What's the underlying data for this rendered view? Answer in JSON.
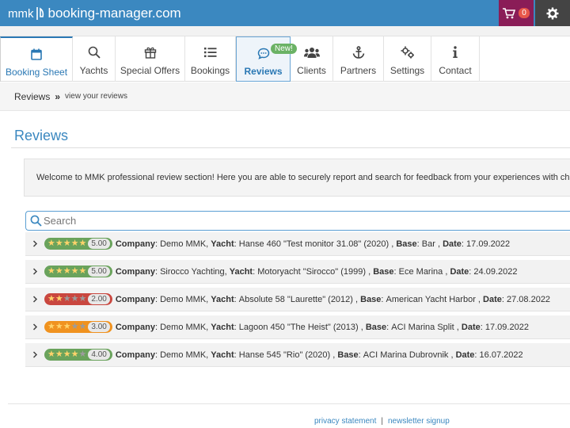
{
  "header": {
    "logo_prefix": "mmk",
    "logo_text": "booking-manager.com",
    "cart_count": "0"
  },
  "tabs": [
    {
      "label": "Booking Sheet",
      "icon": "calendar-icon"
    },
    {
      "label": "Yachts",
      "icon": "search-icon"
    },
    {
      "label": "Special Offers",
      "icon": "gift-icon"
    },
    {
      "label": "Bookings",
      "icon": "list-icon"
    },
    {
      "label": "Reviews",
      "icon": "comment-icon",
      "badge": "New!"
    },
    {
      "label": "Clients",
      "icon": "users-icon"
    },
    {
      "label": "Partners",
      "icon": "anchor-icon"
    },
    {
      "label": "Settings",
      "icon": "gears-icon"
    },
    {
      "label": "Contact",
      "icon": "info-icon"
    }
  ],
  "breadcrumb": {
    "main": "Reviews",
    "separator": "»",
    "sub": "view your reviews"
  },
  "page": {
    "title": "Reviews",
    "welcome": "Welcome to MMK professional review section! Here you are able to securely report and search for feedback from your experiences with charter operators."
  },
  "search": {
    "placeholder": "Search"
  },
  "labels": {
    "company": "Company",
    "yacht": "Yacht",
    "base": "Base",
    "date": "Date"
  },
  "reviews": [
    {
      "rating": 5,
      "rating_label": "5.00",
      "color": "#6aa35c",
      "company": "Demo MMK",
      "yacht": "Hanse 460 \"Test monitor 31.08\" (2020)",
      "base": "Bar",
      "date": "17.09.2022"
    },
    {
      "rating": 5,
      "rating_label": "5.00",
      "color": "#6aa35c",
      "company": "Sirocco Yachting",
      "yacht": "Motoryacht \"Sirocco\" (1999)",
      "base": "Ece Marina",
      "date": "24.09.2022"
    },
    {
      "rating": 2,
      "rating_label": "2.00",
      "color": "#c9473f",
      "company": "Demo MMK",
      "yacht": "Absolute 58 \"Laurette\" (2012)",
      "base": "American Yacht Harbor",
      "date": "27.08.2022"
    },
    {
      "rating": 3,
      "rating_label": "3.00",
      "color": "#f0921f",
      "company": "Demo MMK",
      "yacht": "Lagoon 450 \"The Heist\" (2013)",
      "base": "ACI Marina Split",
      "date": "17.09.2022"
    },
    {
      "rating": 4,
      "rating_label": "4.00",
      "color": "#6aa35c",
      "company": "Demo MMK",
      "yacht": "Hanse 545 \"Rio\" (2020)",
      "base": "ACI Marina Dubrovnik",
      "date": "16.07.2022"
    }
  ],
  "footer": {
    "privacy": "privacy statement",
    "separator": "|",
    "newsletter": "newsletter signup"
  },
  "colors": {
    "brand": "#3b88c0",
    "cart": "#8a1d57",
    "settings": "#444444",
    "star_on": "#ffd36b",
    "star_off": "#9c9c9c"
  }
}
